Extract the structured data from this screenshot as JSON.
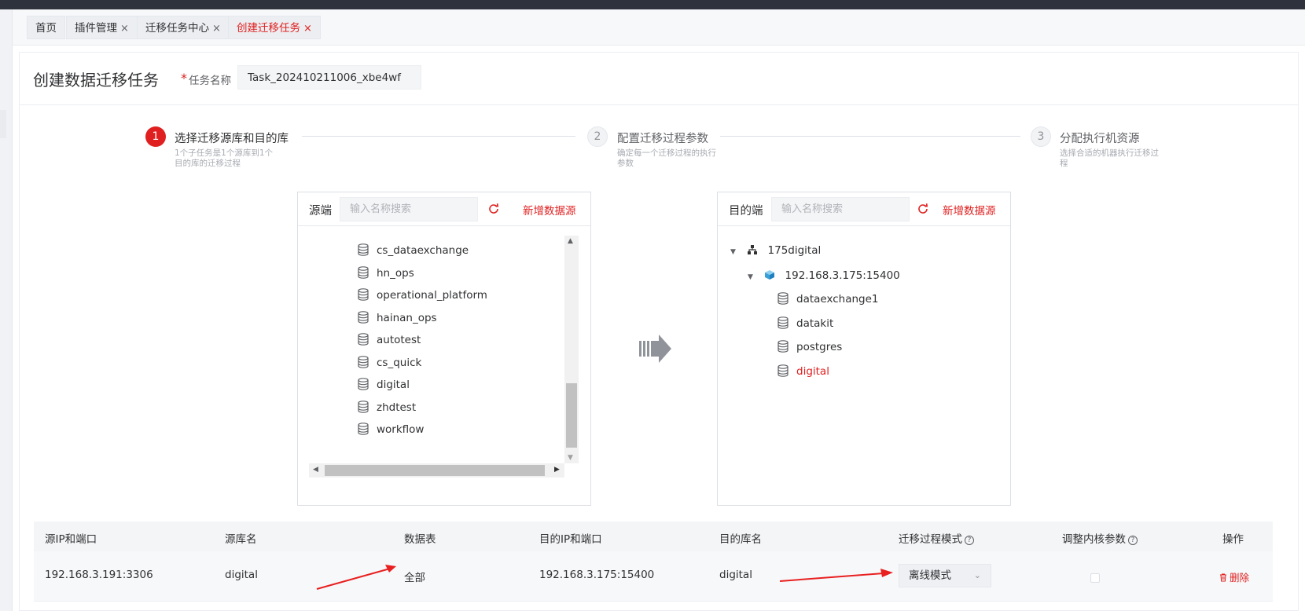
{
  "tabs": [
    {
      "label": "首页",
      "closable": false
    },
    {
      "label": "插件管理",
      "closable": true
    },
    {
      "label": "迁移任务中心",
      "closable": true
    },
    {
      "label": "创建迁移任务",
      "closable": true,
      "active": true
    }
  ],
  "tab_close_glyph": "×",
  "page": {
    "title": "创建数据迁移任务",
    "task_name_required": "*",
    "task_name_label": "任务名称",
    "task_name_value": "Task_202410211006_xbe4wf"
  },
  "steps": [
    {
      "num": "1",
      "title": "选择迁移源库和目的库",
      "desc": "1个子任务是1个源库到1个目的库的迁移过程",
      "active": true
    },
    {
      "num": "2",
      "title": "配置迁移过程参数",
      "desc": "确定每一个迁移过程的执行参数",
      "active": false
    },
    {
      "num": "3",
      "title": "分配执行机资源",
      "desc": "选择合适的机器执行迁移过程",
      "active": false
    }
  ],
  "source_panel": {
    "label": "源端",
    "search_placeholder": "输入名称搜索",
    "add_label": "新增数据源",
    "items": [
      "cs_dataexchange",
      "hn_ops",
      "operational_platform",
      "hainan_ops",
      "autotest",
      "cs_quick",
      "digital",
      "zhdtest",
      "workflow"
    ]
  },
  "target_panel": {
    "label": "目的端",
    "search_placeholder": "输入名称搜索",
    "add_label": "新增数据源",
    "root": "175digital",
    "instance": "192.168.3.175:15400",
    "databases": [
      "dataexchange1",
      "datakit",
      "postgres",
      "digital"
    ],
    "selected": "digital"
  },
  "table": {
    "headers": {
      "src_ip": "源IP和端口",
      "src_db": "源库名",
      "tables": "数据表",
      "dst_ip": "目的IP和端口",
      "dst_db": "目的库名",
      "mode": "迁移过程模式",
      "kernel": "调整内核参数",
      "ops": "操作"
    },
    "help_glyph": "?",
    "row": {
      "src_ip": "192.168.3.191:3306",
      "src_db": "digital",
      "tables": "全部",
      "dst_ip": "192.168.3.175:15400",
      "dst_db": "digital",
      "mode": "离线模式",
      "mode_chevron": "⌄",
      "kernel_checked": false,
      "delete_label": "删除"
    }
  },
  "colors": {
    "accent": "#e02020",
    "topbar": "#2d323d"
  },
  "icons": [
    "close-icon",
    "refresh-icon",
    "database-icon",
    "tree-root-icon",
    "instance-cube-icon",
    "transfer-arrow-icon",
    "help-icon",
    "chevron-down-icon",
    "trash-icon",
    "annotation-arrow"
  ]
}
